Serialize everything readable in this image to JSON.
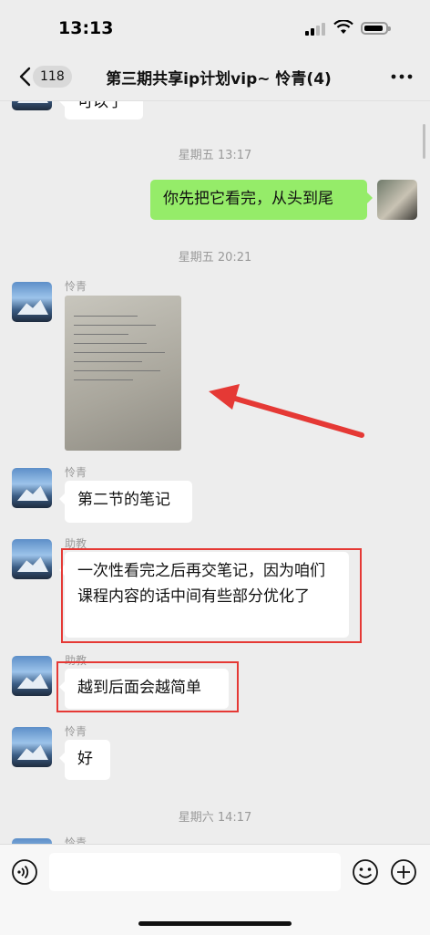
{
  "status": {
    "time": "13:13"
  },
  "nav": {
    "unread_count": "118",
    "title": "第三期共享ip计划vip~ 怜青(4)"
  },
  "messages": {
    "top_partial": "可以了",
    "ts1": "星期五 13:17",
    "me1": "你先把它看完，从头到尾",
    "ts2": "星期五 20:21",
    "sender_lingqing": "怜青",
    "sender_assistant": "助教",
    "m_notes": "第二节的笔记",
    "m_long": "一次性看完之后再交笔记，因为咱们课程内容的话中间有些部分优化了",
    "m_simple": "越到后面会越简单",
    "m_ok": "好",
    "ts3": "星期六 14:17"
  },
  "icons": {
    "back": "chevron-left-icon",
    "more": "more-icon",
    "voice": "voice-icon",
    "emoji": "emoji-icon",
    "plus": "plus-icon"
  },
  "colors": {
    "accent_green": "#95ec69",
    "annotation_red": "#e53935"
  }
}
